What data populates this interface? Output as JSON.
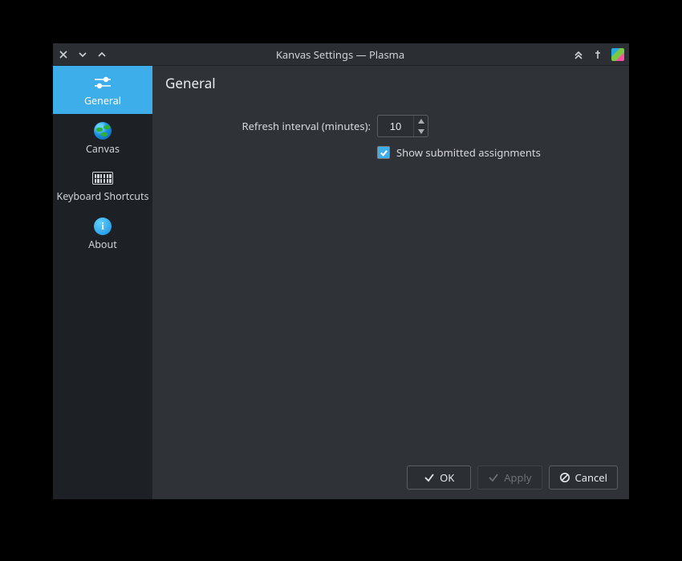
{
  "window": {
    "title": "Kanvas Settings — Plasma"
  },
  "sidebar": {
    "items": [
      {
        "label": "General"
      },
      {
        "label": "Canvas"
      },
      {
        "label": "Keyboard Shortcuts"
      },
      {
        "label": "About"
      }
    ]
  },
  "page": {
    "title": "General",
    "refresh_label": "Refresh interval (minutes):",
    "refresh_value": "10",
    "show_submitted_label": "Show submitted assignments",
    "show_submitted_checked": true
  },
  "buttons": {
    "ok": "OK",
    "apply": "Apply",
    "cancel": "Cancel"
  }
}
